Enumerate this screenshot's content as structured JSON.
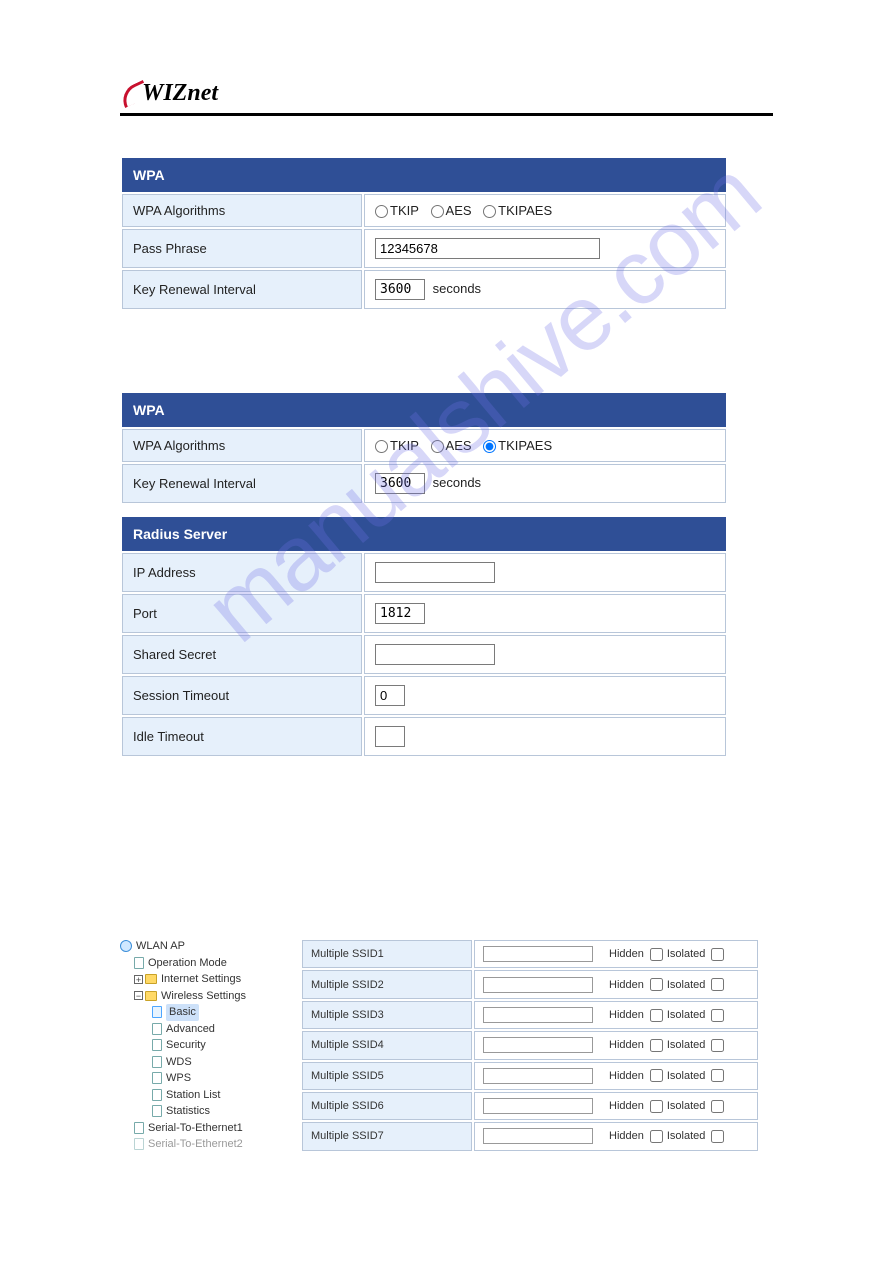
{
  "logo": {
    "text": "WIZnet"
  },
  "watermark": "manualshive.com",
  "wpa1": {
    "header": "WPA",
    "algo_label": "WPA Algorithms",
    "algo_tkip": "TKIP",
    "algo_aes": "AES",
    "algo_tkipaes": "TKIPAES",
    "pass_label": "Pass Phrase",
    "pass_value": "12345678",
    "renew_label": "Key Renewal Interval",
    "renew_value": "3600",
    "renew_unit": "seconds"
  },
  "wpa2": {
    "header": "WPA",
    "algo_label": "WPA Algorithms",
    "algo_tkip": "TKIP",
    "algo_aes": "AES",
    "algo_tkipaes": "TKIPAES",
    "renew_label": "Key Renewal Interval",
    "renew_value": "3600",
    "renew_unit": "seconds"
  },
  "radius": {
    "header": "Radius Server",
    "ip_label": "IP Address",
    "ip_value": "",
    "port_label": "Port",
    "port_value": "1812",
    "secret_label": "Shared Secret",
    "secret_value": "",
    "sess_label": "Session Timeout",
    "sess_value": "0",
    "idle_label": "Idle Timeout",
    "idle_value": ""
  },
  "tree": {
    "root": "WLAN AP",
    "op_mode": "Operation Mode",
    "internet": "Internet Settings",
    "wireless": "Wireless Settings",
    "basic": "Basic",
    "advanced": "Advanced",
    "security": "Security",
    "wds": "WDS",
    "wps": "WPS",
    "station": "Station List",
    "stats": "Statistics",
    "s2e1": "Serial-To-Ethernet1",
    "s2e2": "Serial-To-Ethernet2"
  },
  "ssid": {
    "rows": [
      {
        "label": "Multiple SSID1"
      },
      {
        "label": "Multiple SSID2"
      },
      {
        "label": "Multiple SSID3"
      },
      {
        "label": "Multiple SSID4"
      },
      {
        "label": "Multiple SSID5"
      },
      {
        "label": "Multiple SSID6"
      },
      {
        "label": "Multiple SSID7"
      }
    ],
    "hidden": "Hidden",
    "isolated": "Isolated"
  }
}
